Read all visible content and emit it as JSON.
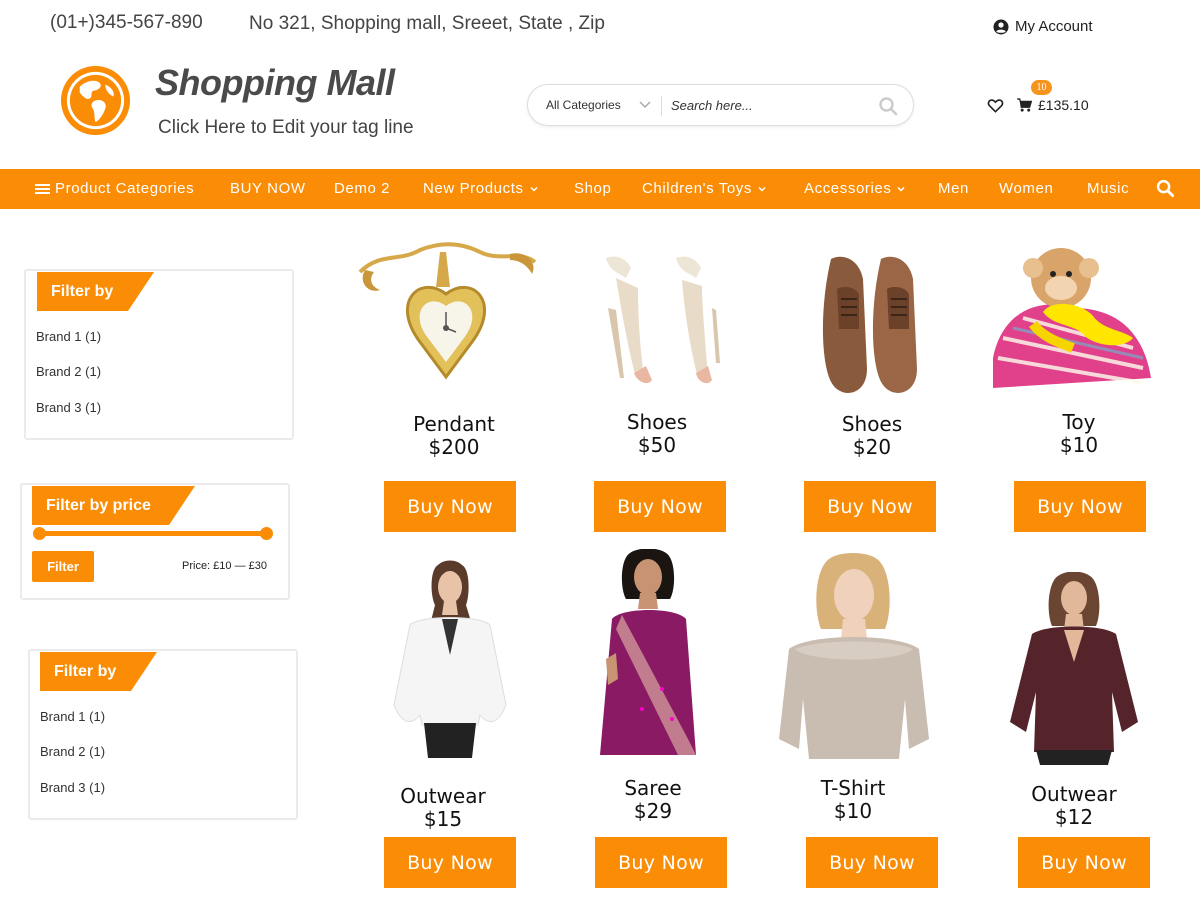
{
  "topbar": {
    "phone": "(01+)345-567-890",
    "address": "No 321, Shopping mall, Sreeet, State , Zip",
    "account_label": "My Account",
    "account_icon": "user-circle-icon"
  },
  "header": {
    "site_title": "Shopping Mall",
    "tagline": "Click Here to Edit your tag line",
    "logo_icon": "globe-icon"
  },
  "search": {
    "category_label": "All Categories",
    "placeholder": "Search here...",
    "value": ""
  },
  "cart": {
    "badge_count": "10",
    "total": "£135.10"
  },
  "nav": {
    "items": [
      {
        "label": "Product Categories"
      },
      {
        "label": "BUY NOW"
      },
      {
        "label": "Demo 2"
      },
      {
        "label": "New Products"
      },
      {
        "label": "Shop"
      },
      {
        "label": "Children's Toys"
      },
      {
        "label": "Accessories"
      },
      {
        "label": "Men"
      },
      {
        "label": "Women"
      },
      {
        "label": "Music"
      }
    ]
  },
  "sidebar": {
    "filter1": {
      "title": "Filter by",
      "brands": [
        {
          "name": "Brand 1",
          "count": "(1)"
        },
        {
          "name": "Brand 2",
          "count": "(1)"
        },
        {
          "name": "Brand 3",
          "count": "(1)"
        }
      ]
    },
    "price": {
      "title": "Filter by price",
      "button": "Filter",
      "text": "Price: £10 — £30"
    },
    "filter2": {
      "title": "Filter by",
      "brands": [
        {
          "name": "Brand 1",
          "count": "(1)"
        },
        {
          "name": "Brand 2",
          "count": "(1)"
        },
        {
          "name": "Brand 3",
          "count": "(1)"
        }
      ]
    }
  },
  "products": [
    {
      "name": "Pendant",
      "price": "$200",
      "button": "Buy Now"
    },
    {
      "name": "Shoes",
      "price": "$50",
      "button": "Buy Now"
    },
    {
      "name": "Shoes",
      "price": "$20",
      "button": "Buy Now"
    },
    {
      "name": "Toy",
      "price": "$10",
      "button": "Buy Now"
    },
    {
      "name": "Outwear",
      "price": "$15",
      "button": "Buy Now"
    },
    {
      "name": "Saree",
      "price": "$29",
      "button": "Buy Now"
    },
    {
      "name": "T-Shirt",
      "price": "$10",
      "button": "Buy Now"
    },
    {
      "name": "Outwear",
      "price": "$12",
      "button": "Buy Now"
    }
  ],
  "colors": {
    "accent": "#fb8c05"
  }
}
